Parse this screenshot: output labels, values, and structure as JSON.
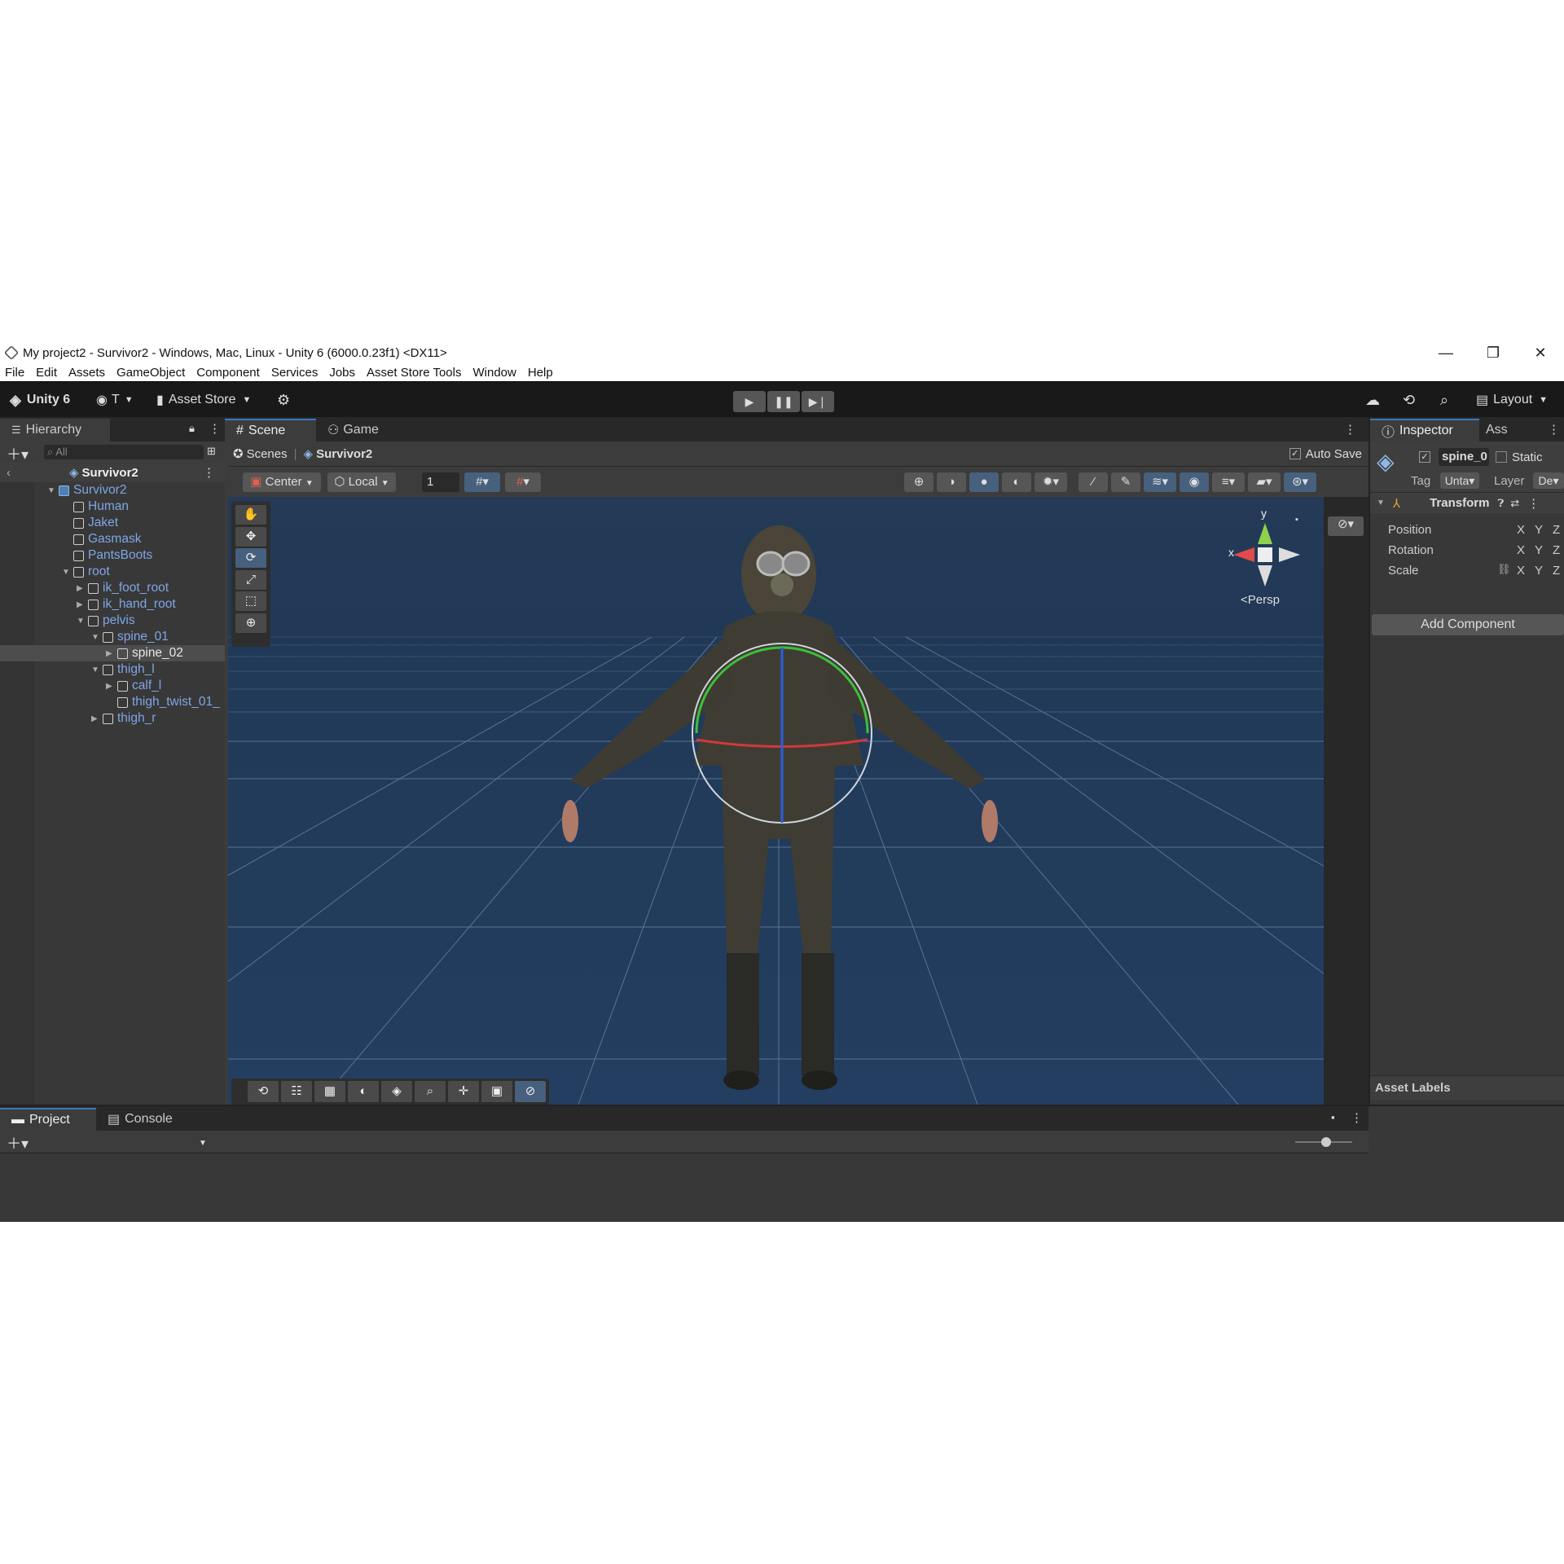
{
  "window": {
    "title": "My project2 - Survivor2 - Windows, Mac, Linux - Unity 6 (6000.0.23f1) <DX11>",
    "minimize": "—",
    "restore": "❐",
    "close": "✕"
  },
  "menu": [
    "File",
    "Edit",
    "Assets",
    "GameObject",
    "Component",
    "Services",
    "Jobs",
    "Asset Store Tools",
    "Window",
    "Help"
  ],
  "toolbar": {
    "unity_label": "Unity 6",
    "account_label": "T",
    "asset_store_label": "Asset Store",
    "layout_label": "Layout"
  },
  "hierarchy": {
    "tab": "Hierarchy",
    "search_placeholder": "All",
    "scene_name": "Survivor2",
    "items": [
      {
        "label": "Survivor2",
        "depth": 0,
        "arrow": "▼",
        "selected": false
      },
      {
        "label": "Human",
        "depth": 1,
        "arrow": "",
        "selected": false
      },
      {
        "label": "Jaket",
        "depth": 1,
        "arrow": "",
        "selected": false
      },
      {
        "label": "Gasmask",
        "depth": 1,
        "arrow": "",
        "selected": false
      },
      {
        "label": "PantsBoots",
        "depth": 1,
        "arrow": "",
        "selected": false
      },
      {
        "label": "root",
        "depth": 1,
        "arrow": "▼",
        "selected": false
      },
      {
        "label": "ik_foot_root",
        "depth": 2,
        "arrow": "▶",
        "selected": false
      },
      {
        "label": "ik_hand_root",
        "depth": 2,
        "arrow": "▶",
        "selected": false
      },
      {
        "label": "pelvis",
        "depth": 2,
        "arrow": "▼",
        "selected": false
      },
      {
        "label": "spine_01",
        "depth": 3,
        "arrow": "▼",
        "selected": false
      },
      {
        "label": "spine_02",
        "depth": 4,
        "arrow": "▶",
        "selected": true
      },
      {
        "label": "thigh_l",
        "depth": 3,
        "arrow": "▼",
        "selected": false
      },
      {
        "label": "calf_l",
        "depth": 4,
        "arrow": "▶",
        "selected": false
      },
      {
        "label": "thigh_twist_01_",
        "depth": 4,
        "arrow": "",
        "selected": false
      },
      {
        "label": "thigh_r",
        "depth": 3,
        "arrow": "▶",
        "selected": false
      }
    ]
  },
  "scene": {
    "tabs": [
      "Scene",
      "Game"
    ],
    "breadcrumb_root": "Scenes",
    "breadcrumb_current": "Survivor2",
    "auto_save": "Auto Save",
    "pivot": "Center",
    "space": "Local",
    "snap_value": "1",
    "persp": "Persp",
    "gizmo_x": "x",
    "gizmo_y": "y"
  },
  "inspector": {
    "tabs": [
      "Inspector",
      "Ass"
    ],
    "object_name": "spine_0",
    "static_label": "Static",
    "tag_label": "Tag",
    "tag_value": "Unta",
    "layer_label": "Layer",
    "layer_value": "De",
    "component": "Transform",
    "fields": [
      "Position",
      "Rotation",
      "Scale"
    ],
    "axes": [
      "X",
      "Y",
      "Z"
    ],
    "add_component": "Add Component",
    "asset_labels": "Asset Labels"
  },
  "bottom": {
    "tabs": [
      "Project",
      "Console"
    ]
  },
  "colors": {
    "accent": "#3a79bb",
    "viewport": "#233e60",
    "panel": "#383838",
    "toolbar": "#191919"
  }
}
